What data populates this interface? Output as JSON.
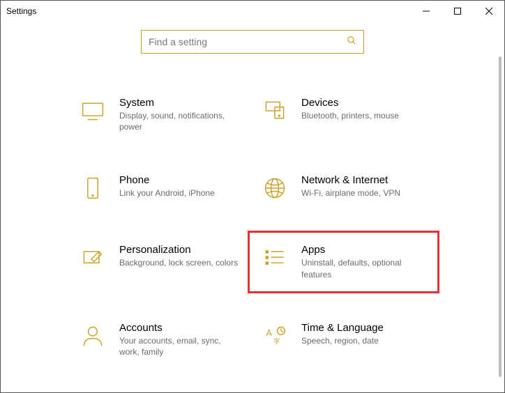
{
  "window": {
    "title": "Settings"
  },
  "search": {
    "placeholder": "Find a setting"
  },
  "tiles": {
    "system": {
      "label": "System",
      "desc": "Display, sound, notifications, power"
    },
    "devices": {
      "label": "Devices",
      "desc": "Bluetooth, printers, mouse"
    },
    "phone": {
      "label": "Phone",
      "desc": "Link your Android, iPhone"
    },
    "network": {
      "label": "Network & Internet",
      "desc": "Wi-Fi, airplane mode, VPN"
    },
    "personalization": {
      "label": "Personalization",
      "desc": "Background, lock screen, colors"
    },
    "apps": {
      "label": "Apps",
      "desc": "Uninstall, defaults, optional features"
    },
    "accounts": {
      "label": "Accounts",
      "desc": "Your accounts, email, sync, work, family"
    },
    "time": {
      "label": "Time & Language",
      "desc": "Speech, region, date"
    }
  }
}
